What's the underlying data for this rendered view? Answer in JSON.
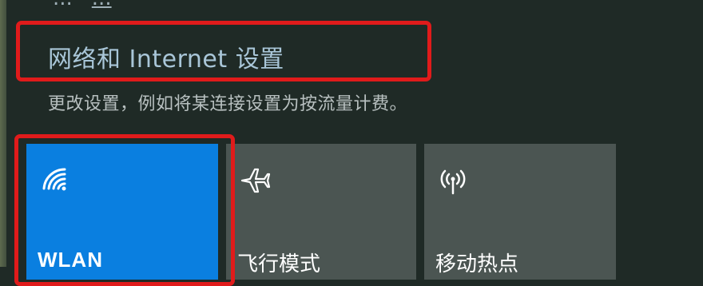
{
  "top_partial": {
    "text_left": "...",
    "text_link": "..."
  },
  "network": {
    "settings_link": "网络和 Internet 设置",
    "settings_desc": "更改设置，例如将某连接设置为按流量计费。"
  },
  "quick_actions": [
    {
      "label": "WLAN",
      "icon": "wifi-icon",
      "state": "on"
    },
    {
      "label": "飞行模式",
      "icon": "airplane-icon",
      "state": "off"
    },
    {
      "label": "移动热点",
      "icon": "mobile-hotspot-icon",
      "state": "off"
    }
  ],
  "colors": {
    "panel_bg": "#1f2a26",
    "tile_on": "#0a7fe0",
    "tile_off": "#4b5552",
    "link": "#a9c6d8",
    "highlight": "#e01b1b"
  }
}
